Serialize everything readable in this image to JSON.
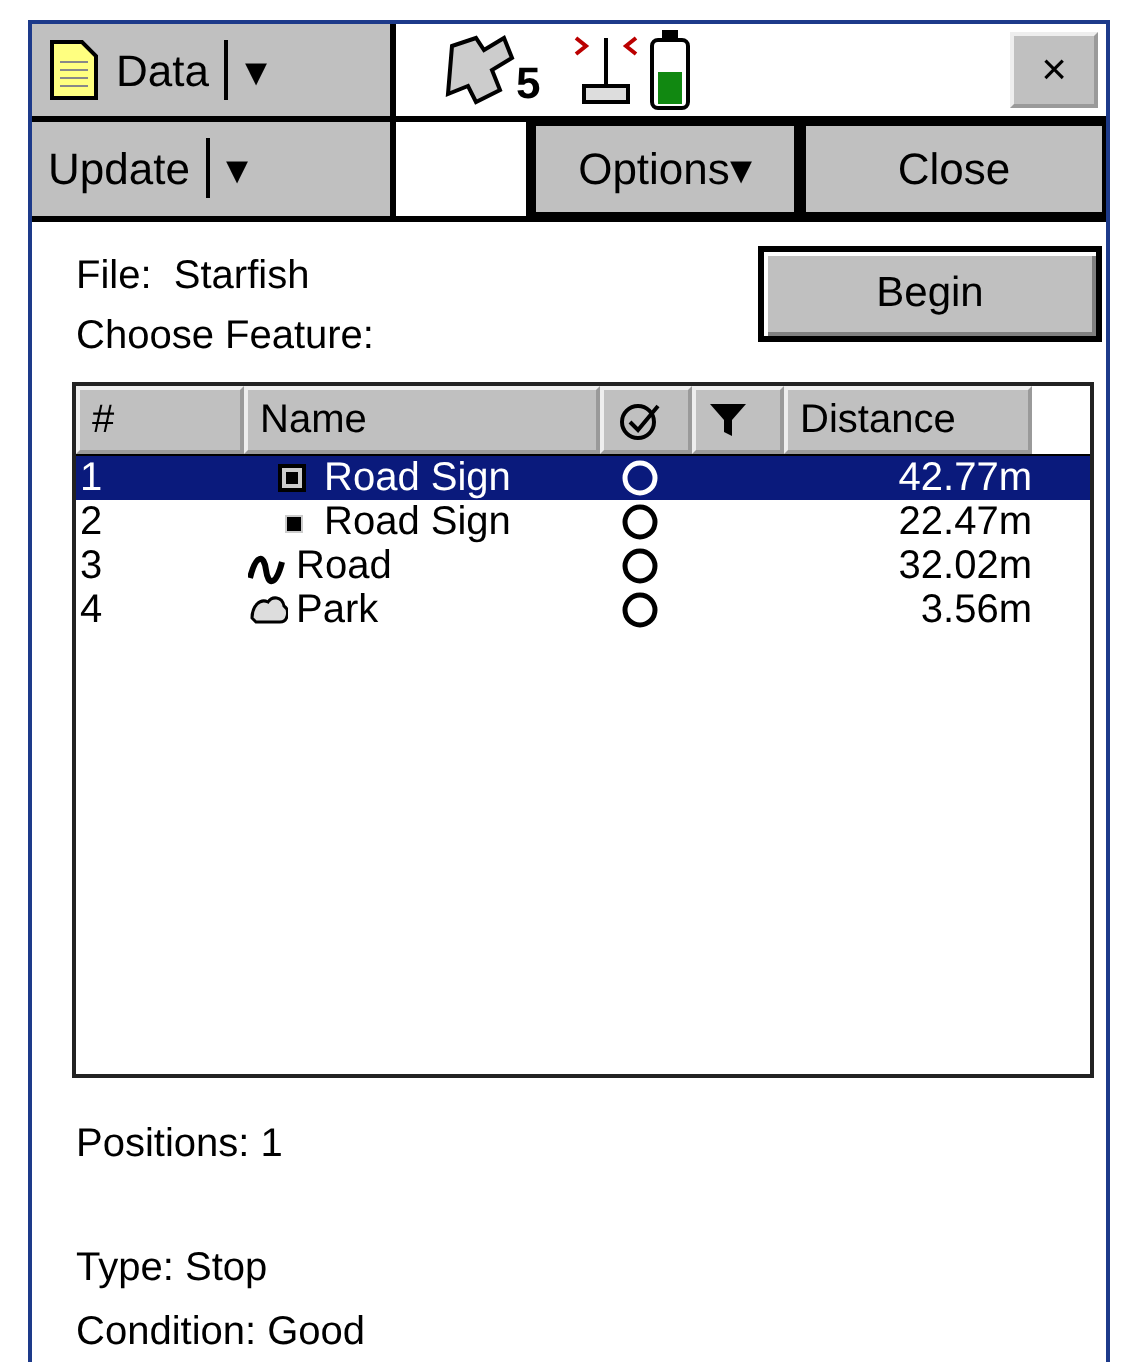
{
  "menu_bar": {
    "data_menu": {
      "label": "Data",
      "arrow": "▾"
    },
    "satellite_count": "5",
    "close_symbol": "×"
  },
  "toolbar": {
    "update": {
      "label": "Update",
      "arrow": "▾"
    },
    "options": "Options▾",
    "close": "Close"
  },
  "file": {
    "label": "File:",
    "value": "Starfish"
  },
  "choose_label": "Choose Feature:",
  "begin": "Begin",
  "table": {
    "columns": [
      "#",
      "Name",
      "Distance"
    ],
    "rows": [
      {
        "index": "1",
        "kind": "point",
        "name": "Road Sign",
        "distance": "42.77m",
        "selected": true
      },
      {
        "index": "2",
        "kind": "point-small",
        "name": "Road Sign",
        "distance": "22.47m",
        "selected": false
      },
      {
        "index": "3",
        "kind": "line",
        "name": "Road",
        "distance": "32.02m",
        "selected": false
      },
      {
        "index": "4",
        "kind": "area",
        "name": "Park",
        "distance": "3.56m",
        "selected": false
      }
    ]
  },
  "positions": "Positions: 1",
  "type": "Type: Stop",
  "condition": "Condition: Good"
}
